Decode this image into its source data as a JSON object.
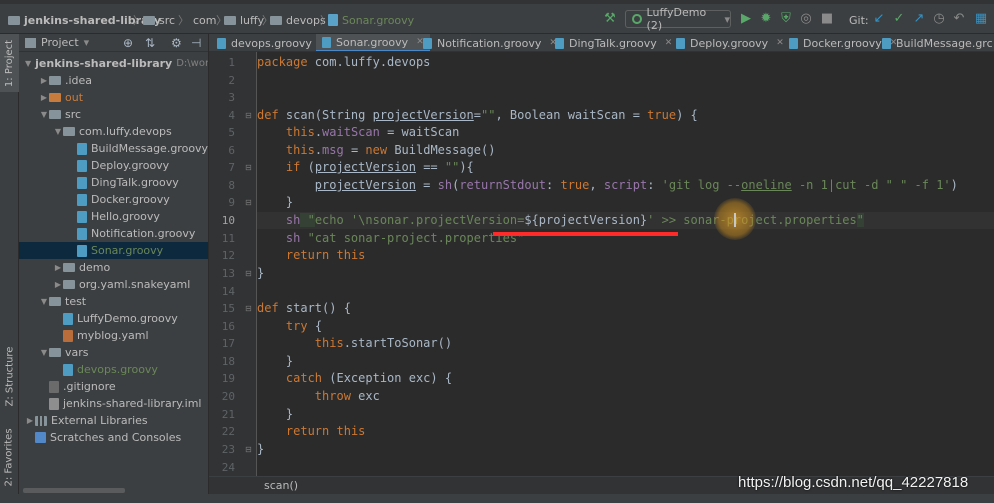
{
  "nav": {
    "crumbs": [
      "jenkins-shared-library",
      "src",
      "com",
      "luffy",
      "devops",
      "Sonar.groovy"
    ],
    "run_config": "LuffyDemo (2)",
    "git_label": "Git:"
  },
  "left_strip": {
    "project_tab": "1: Project",
    "structure_tab": "Z: Structure",
    "favorites_tab": "2: Favorites"
  },
  "project_panel": {
    "title": "Project",
    "tree": [
      {
        "label": "jenkins-shared-library",
        "extra": "D:\\workspa",
        "indent": 0,
        "type": "folder",
        "open": true
      },
      {
        "label": ".idea",
        "indent": 1,
        "type": "folder",
        "open": false
      },
      {
        "label": "out",
        "indent": 1,
        "type": "folder-orange",
        "open": false
      },
      {
        "label": "src",
        "indent": 1,
        "type": "folder",
        "open": true
      },
      {
        "label": "com.luffy.devops",
        "indent": 2,
        "type": "pkg",
        "open": true
      },
      {
        "label": "BuildMessage.groovy",
        "indent": 3,
        "type": "groovy"
      },
      {
        "label": "Deploy.groovy",
        "indent": 3,
        "type": "groovy"
      },
      {
        "label": "DingTalk.groovy",
        "indent": 3,
        "type": "groovy"
      },
      {
        "label": "Docker.groovy",
        "indent": 3,
        "type": "groovy"
      },
      {
        "label": "Hello.groovy",
        "indent": 3,
        "type": "groovy"
      },
      {
        "label": "Notification.groovy",
        "indent": 3,
        "type": "groovy"
      },
      {
        "label": "Sonar.groovy",
        "indent": 3,
        "type": "groovy",
        "selected": true
      },
      {
        "label": "demo",
        "indent": 2,
        "type": "pkg",
        "open": false
      },
      {
        "label": "org.yaml.snakeyaml",
        "indent": 2,
        "type": "pkg",
        "open": false
      },
      {
        "label": "test",
        "indent": 1,
        "type": "folder",
        "open": true
      },
      {
        "label": "LuffyDemo.groovy",
        "indent": 2,
        "type": "groovy"
      },
      {
        "label": "myblog.yaml",
        "indent": 2,
        "type": "yaml"
      },
      {
        "label": "vars",
        "indent": 1,
        "type": "folder",
        "open": true
      },
      {
        "label": "devops.groovy",
        "indent": 2,
        "type": "groovy",
        "vars": true
      },
      {
        "label": ".gitignore",
        "indent": 1,
        "type": "git"
      },
      {
        "label": "jenkins-shared-library.iml",
        "indent": 1,
        "type": "iml"
      },
      {
        "label": "External Libraries",
        "indent": 0,
        "type": "lib",
        "open": false
      },
      {
        "label": "Scratches and Consoles",
        "indent": 0,
        "type": "scratch"
      }
    ]
  },
  "editor": {
    "tabs": [
      {
        "label": "devops.groovy",
        "active": false
      },
      {
        "label": "Sonar.groovy",
        "active": true
      },
      {
        "label": "Notification.groovy",
        "active": false
      },
      {
        "label": "DingTalk.groovy",
        "active": false
      },
      {
        "label": "Deploy.groovy",
        "active": false
      },
      {
        "label": "Docker.groovy",
        "active": false
      },
      {
        "label": "BuildMessage.grc",
        "active": false
      }
    ],
    "line_numbers": [
      "1",
      "2",
      "3",
      "4",
      "5",
      "6",
      "7",
      "8",
      "9",
      "10",
      "11",
      "12",
      "13",
      "14",
      "15",
      "16",
      "17",
      "18",
      "19",
      "20",
      "21",
      "22",
      "23",
      "24"
    ],
    "current_line": 10,
    "code": {
      "l1_kw": "package",
      "l1_rest": " com.luffy.devops",
      "l4_kw": "def",
      "l4_name": " scan(String ",
      "l4_param": "projectVersion",
      "l4_eq": "=",
      "l4_str": "\"\"",
      "l4_mid": ", Boolean waitScan = ",
      "l4_true": "true",
      "l4_end": ") {",
      "l5_this": "this",
      "l5_dot": ".",
      "l5_field": "waitScan",
      "l5_rest": " = waitScan",
      "l6_this": "this",
      "l6_dot": ".",
      "l6_field": "msg",
      "l6_eq": " = ",
      "l6_new": "new",
      "l6_rest": " BuildMessage()",
      "l7_if": "if",
      "l7_a": " (",
      "l7_param": "projectVersion",
      "l7_b": " == ",
      "l7_str": "\"\"",
      "l7_c": "){",
      "l8_param": "projectVersion",
      "l8_a": " = ",
      "l8_sh": "sh",
      "l8_b": "(",
      "l8_ret": "returnStdout",
      "l8_c": ": ",
      "l8_true": "true",
      "l8_d": ", ",
      "l8_script": "script",
      "l8_e": ": ",
      "l8_str1": "'git log --",
      "l8_oneline": "oneline",
      "l8_str2": " -n 1|cut -d \" \" -f 1'",
      "l8_end": ")",
      "l9": "}",
      "l10_sh": "sh",
      "l10_q": " \"",
      "l10_a": "echo '\\nsonar.projectVersion=",
      "l10_interp": "${projectVersion}",
      "l10_b": "' >> sonar-project.properties",
      "l10_q2": "\"",
      "l11_sh": "sh",
      "l11_str": " \"cat sonar-project.properties\"",
      "l12_ret": "return",
      "l12_this": " this",
      "l13": "}",
      "l15_kw": "def",
      "l15_rest": " start() {",
      "l16_kw": "try",
      "l16_rest": " {",
      "l17_this": "this",
      "l17_rest": ".startToSonar()",
      "l18": "}",
      "l19_kw": "catch",
      "l19_rest": " (Exception exc) {",
      "l20_kw": "throw",
      "l20_rest": " exc",
      "l21": "}",
      "l22_ret": "return",
      "l22_this": " this",
      "l23": "}"
    },
    "breadcrumb": "scan()"
  },
  "watermark": "https://blog.csdn.net/qq_42227818",
  "colors": {
    "keyword": "#cc7832",
    "string": "#6a8759",
    "field": "#9876aa",
    "function": "#ffc66d",
    "annotation_red": "#ff2a2a"
  }
}
